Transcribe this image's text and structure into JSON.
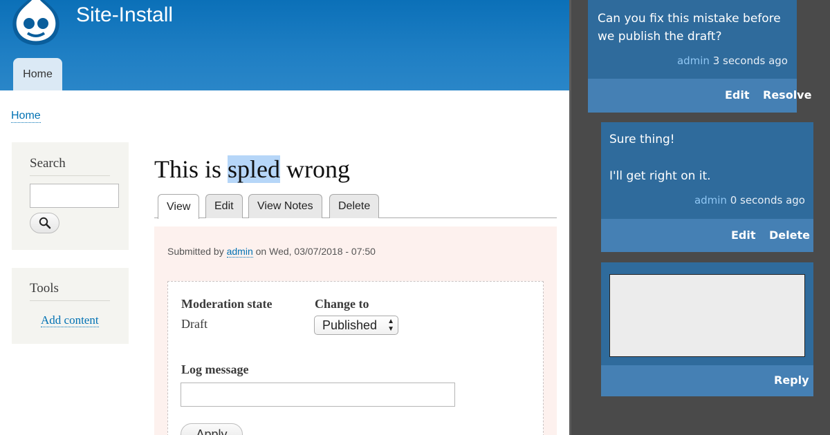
{
  "site": {
    "name": "Site-Install"
  },
  "nav": {
    "primary_tab": "Home"
  },
  "breadcrumb": {
    "home": "Home"
  },
  "sidebar": {
    "search_title": "Search",
    "tools_title": "Tools",
    "add_content": "Add content"
  },
  "node": {
    "title_before": "This is ",
    "title_highlight": "spled",
    "title_after": " wrong",
    "tabs": [
      "View",
      "Edit",
      "View Notes",
      "Delete"
    ],
    "submitted_prefix": "Submitted by ",
    "author": "admin",
    "submitted_suffix": " on Wed, 03/07/2018 - 07:50"
  },
  "moderation": {
    "state_label": "Moderation state",
    "state_value": "Draft",
    "change_label": "Change to",
    "change_value": "Published",
    "log_label": "Log message",
    "apply": "Apply"
  },
  "comments": [
    {
      "text": "Can you fix this mistake before we publish the draft?",
      "author": "admin",
      "time": " 3 seconds ago",
      "actions": [
        "Edit",
        "Resolve"
      ]
    },
    {
      "text_line1": "Sure thing!",
      "text_line2": "I'll get right on it.",
      "author": "admin",
      "time": " 0 seconds ago",
      "actions": [
        "Edit",
        "Delete"
      ]
    }
  ],
  "reply": {
    "button": "Reply"
  },
  "colors": {
    "header": "#1f7fc4",
    "link": "#0071b3",
    "comment_card": "#2f6b9c",
    "comment_footer": "#4580b4",
    "panel_bg": "#4a4a4a",
    "highlight": "#b6d6f8"
  },
  "icons": [
    "drupal-logo-icon",
    "search-icon",
    "select-arrows-icon"
  ]
}
